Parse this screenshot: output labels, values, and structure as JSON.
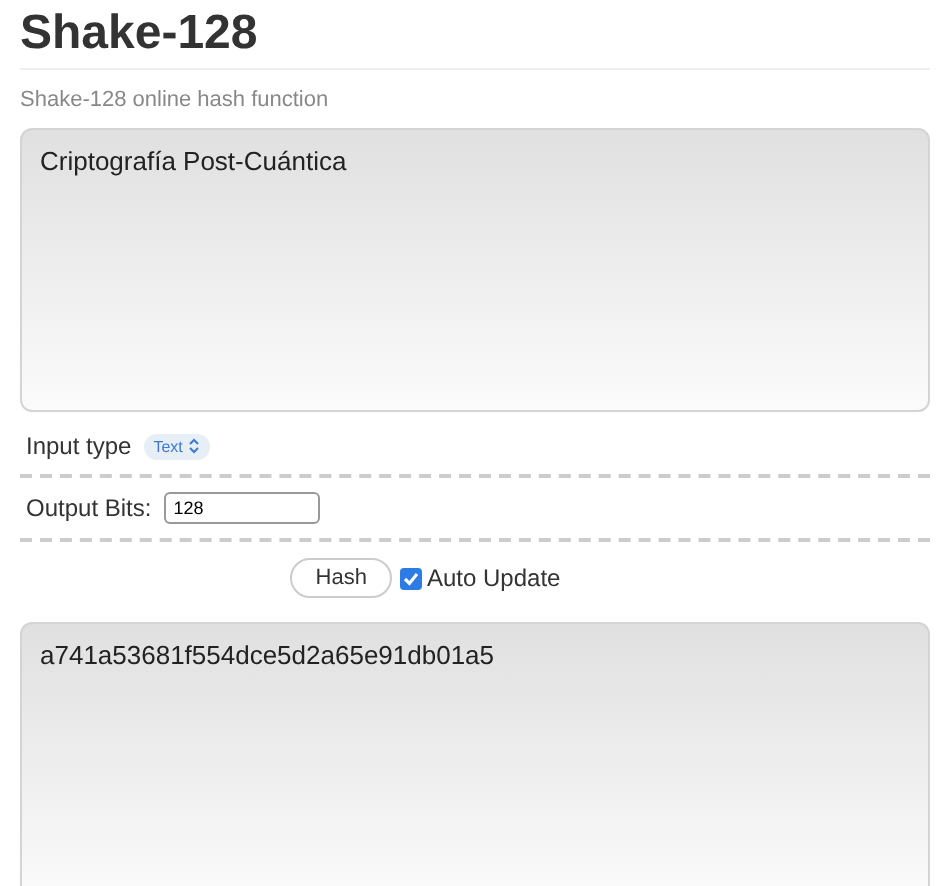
{
  "title": "Shake-128",
  "subtitle": "Shake-128 online hash function",
  "input": {
    "value": "Criptografía Post-Cuántica"
  },
  "input_type": {
    "label": "Input type",
    "value": "Text"
  },
  "output_bits": {
    "label": "Output Bits:",
    "value": "128"
  },
  "hash_button": "Hash",
  "auto_update": {
    "label": "Auto Update",
    "checked": true
  },
  "output": {
    "value": "a741a53681f554dce5d2a65e91db01a5"
  }
}
